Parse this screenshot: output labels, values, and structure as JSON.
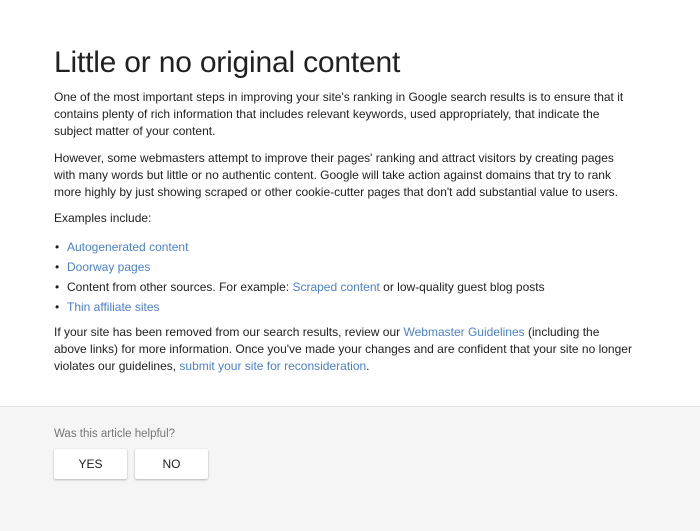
{
  "article": {
    "title": "Little or no original content",
    "paragraph1": "One of the most important steps in improving your site's ranking in Google search results is to ensure that it contains plenty of rich information that includes relevant keywords, used appropriately, that indicate the subject matter of your content.",
    "paragraph2": "However, some webmasters attempt to improve their pages' ranking and attract visitors by creating pages with many words but little or no authentic content. Google will take action against domains that try to rank more highly by just showing scraped or other cookie-cutter pages that don't add substantial value to users.",
    "examples_intro": "Examples include:",
    "bullet": "•",
    "list": {
      "item1_link": "Autogenerated content",
      "item2_link": "Doorway pages",
      "item3_pre": "Content from other sources. For example: ",
      "item3_link": "Scraped content",
      "item3_post": " or low-quality guest blog posts",
      "item4_link": "Thin affiliate sites"
    },
    "closing": {
      "pre": "If your site has been removed from our search results, review our ",
      "link1": "Webmaster Guidelines",
      "mid": " (including the above links) for more information. Once you've made your changes and are confident that your site no longer violates our guidelines, ",
      "link2": "submit your site for reconsideration",
      "post": "."
    }
  },
  "feedback": {
    "question": "Was this article helpful?",
    "yes_label": "YES",
    "no_label": "NO"
  },
  "colors": {
    "link": "#4a7fd4",
    "text": "#212121",
    "feedback_bg": "#f5f5f5",
    "muted": "#757575"
  }
}
